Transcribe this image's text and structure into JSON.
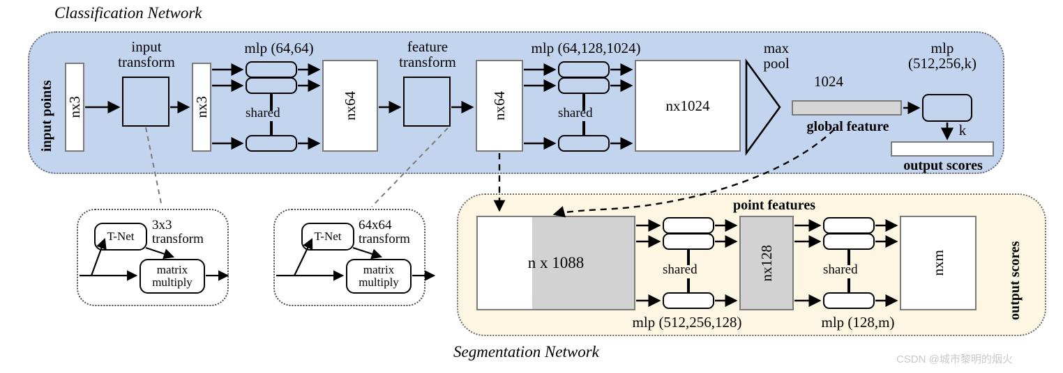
{
  "figure": {
    "watermark": "CSDN @城市黎明的烟火"
  },
  "classification_network": {
    "title": "Classification Network",
    "side_label": "input points",
    "labels": {
      "input_transform": "input\ntransform",
      "mlp_64_64": "mlp (64,64)",
      "feature_transform": "feature\ntransform",
      "mlp_64_128_1024": "mlp (64,128,1024)",
      "max_pool": "max\npool",
      "global_dim": "1024",
      "global_feature": "global feature",
      "mlp_512_256_k": "mlp\n(512,256,k)",
      "k": "k",
      "output_scores": "output scores",
      "shared_1": "shared",
      "shared_2": "shared"
    },
    "boxes": {
      "nx3_in": "nx3",
      "nx3_out": "nx3",
      "nx64_a": "nx64",
      "nx64_b": "nx64",
      "nx1024": "nx1024"
    }
  },
  "tnet_input": {
    "tnet": "T-Net",
    "transform_label": "3x3\ntransform",
    "matrix_multiply": "matrix\nmultiply"
  },
  "tnet_feature": {
    "tnet": "T-Net",
    "transform_label": "64x64\ntransform",
    "matrix_multiply": "matrix\nmultiply"
  },
  "segmentation_network": {
    "title": "Segmentation Network",
    "side_label": "output scores",
    "labels": {
      "point_features": "point features",
      "mlp_512_256_128": "mlp (512,256,128)",
      "mlp_128_m": "mlp (128,m)",
      "shared_1": "shared",
      "shared_2": "shared"
    },
    "boxes": {
      "n_part": "n",
      "x1088_part": "x 1088",
      "nx128": "nx128",
      "nxm": "nxm"
    }
  },
  "colors": {
    "classification_panel": "#c3d4ef",
    "segmentation_panel": "#fdf6e3",
    "global_feature": "#d6d6d6",
    "point_feature_gray": "#d2d2d2",
    "stroke": "#000000",
    "box_border": "#7a7a7a",
    "watermark": "#c9c9c9"
  }
}
